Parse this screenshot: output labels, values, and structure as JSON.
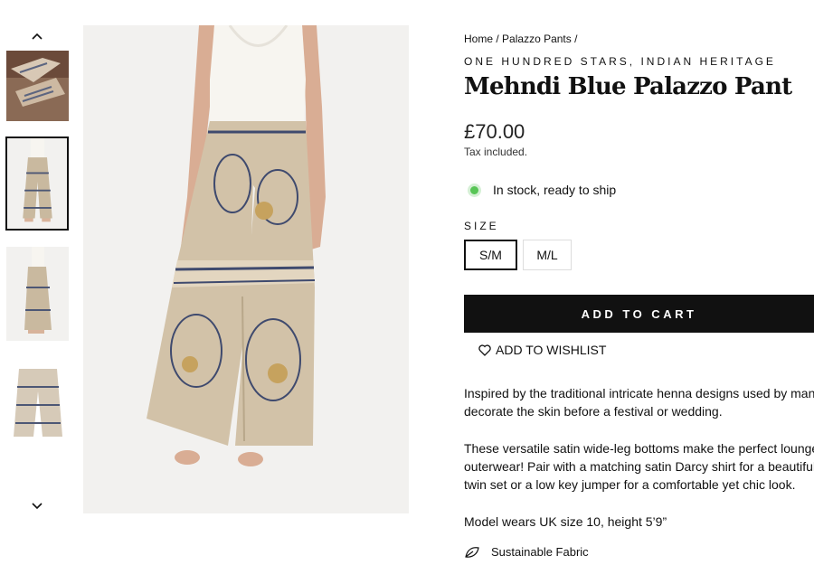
{
  "gallery": {
    "thumbs": [
      {
        "alt": "folded palazzo pants on patterned rug"
      },
      {
        "alt": "front view model wearing pants"
      },
      {
        "alt": "side view model wearing pants"
      },
      {
        "alt": "flat lay of pants"
      }
    ],
    "active_index": 1
  },
  "product": {
    "breadcrumb": {
      "home": "Home",
      "sep": "/",
      "category": "Palazzo Pants",
      "trail": "/"
    },
    "vendor": "ONE HUNDRED STARS, INDIAN HERITAGE",
    "title": "Mehndi Blue Palazzo Pant",
    "price": "£70.00",
    "tax_note": "Tax included.",
    "stock_text": "In stock, ready to ship",
    "size_label": "SIZE",
    "sizes": [
      "S/M",
      "M/L"
    ],
    "selected_size": "S/M",
    "add_to_cart": "ADD TO CART",
    "wishlist": "ADD TO WISHLIST",
    "description": [
      "Inspired by the traditional intricate henna designs used by many to",
      "decorate the skin before a festival or wedding.",
      "These versatile satin wide-leg bottoms make the perfect lounge or",
      "outerwear! Pair with a matching satin Darcy shirt for a beautiful",
      "twin set or a low key jumper for a comfortable yet chic look.",
      "Model wears UK size 10, height 5’9”"
    ],
    "sustainable_text": "Sustainable Fabric"
  },
  "colors": {
    "accent": "#111111",
    "stock_dot": "#58c556"
  }
}
